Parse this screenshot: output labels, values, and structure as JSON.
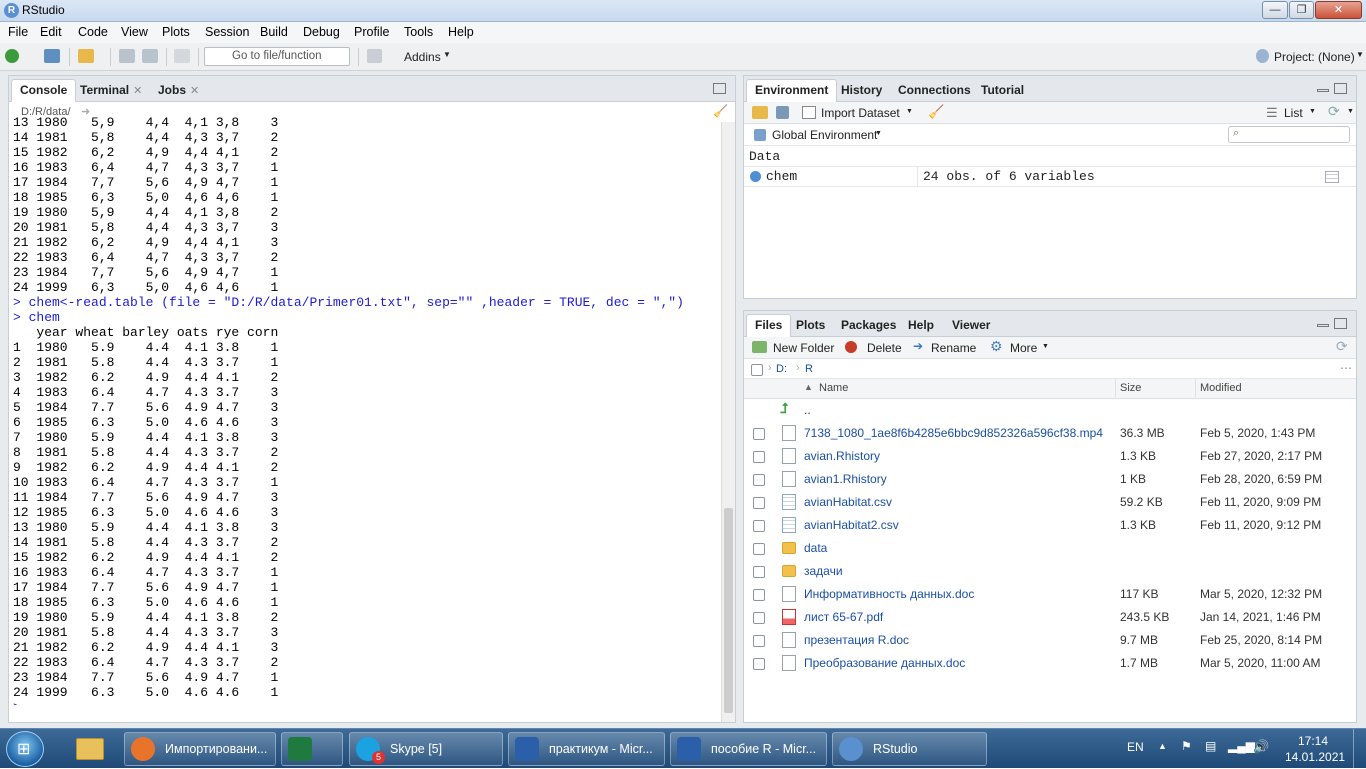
{
  "window": {
    "title": "RStudio",
    "minimize": "—",
    "maximize": "❐",
    "close": "✕"
  },
  "menu": [
    "File",
    "Edit",
    "Code",
    "View",
    "Plots",
    "Session",
    "Build",
    "Debug",
    "Profile",
    "Tools",
    "Help"
  ],
  "toolbar": {
    "goto_placeholder": "Go to file/function",
    "addins": "Addins",
    "project": "Project: (None)"
  },
  "console": {
    "tabs": [
      {
        "label": "Console"
      },
      {
        "label": "Terminal"
      },
      {
        "label": "Jobs"
      }
    ],
    "path": "D:/R/data/",
    "lines": [
      {
        "text": "13 1980   5,9    4,4  4,1 3,8    3",
        "type": "out"
      },
      {
        "text": "14 1981   5,8    4,4  4,3 3,7    2",
        "type": "out"
      },
      {
        "text": "15 1982   6,2    4,9  4,4 4,1    2",
        "type": "out"
      },
      {
        "text": "16 1983   6,4    4,7  4,3 3,7    1",
        "type": "out"
      },
      {
        "text": "17 1984   7,7    5,6  4,9 4,7    1",
        "type": "out"
      },
      {
        "text": "18 1985   6,3    5,0  4,6 4,6    1",
        "type": "out"
      },
      {
        "text": "19 1980   5,9    4,4  4,1 3,8    2",
        "type": "out"
      },
      {
        "text": "20 1981   5,8    4,4  4,3 3,7    3",
        "type": "out"
      },
      {
        "text": "21 1982   6,2    4,9  4,4 4,1    3",
        "type": "out"
      },
      {
        "text": "22 1983   6,4    4,7  4,3 3,7    2",
        "type": "out"
      },
      {
        "text": "23 1984   7,7    5,6  4,9 4,7    1",
        "type": "out"
      },
      {
        "text": "24 1999   6,3    5,0  4,6 4,6    1",
        "type": "out"
      },
      {
        "text": "> chem<-read.table (file = \"D:/R/data/Primer01.txt\", sep=\"\" ,header = TRUE, dec = \",\")",
        "type": "cmd"
      },
      {
        "text": "> chem",
        "type": "cmd"
      },
      {
        "text": "   year wheat barley oats rye corn",
        "type": "out"
      },
      {
        "text": "1  1980   5.9    4.4  4.1 3.8    1",
        "type": "out"
      },
      {
        "text": "2  1981   5.8    4.4  4.3 3.7    1",
        "type": "out"
      },
      {
        "text": "3  1982   6.2    4.9  4.4 4.1    2",
        "type": "out"
      },
      {
        "text": "4  1983   6.4    4.7  4.3 3.7    3",
        "type": "out"
      },
      {
        "text": "5  1984   7.7    5.6  4.9 4.7    3",
        "type": "out"
      },
      {
        "text": "6  1985   6.3    5.0  4.6 4.6    3",
        "type": "out"
      },
      {
        "text": "7  1980   5.9    4.4  4.1 3.8    3",
        "type": "out"
      },
      {
        "text": "8  1981   5.8    4.4  4.3 3.7    2",
        "type": "out"
      },
      {
        "text": "9  1982   6.2    4.9  4.4 4.1    2",
        "type": "out"
      },
      {
        "text": "10 1983   6.4    4.7  4.3 3.7    1",
        "type": "out"
      },
      {
        "text": "11 1984   7.7    5.6  4.9 4.7    3",
        "type": "out"
      },
      {
        "text": "12 1985   6.3    5.0  4.6 4.6    3",
        "type": "out"
      },
      {
        "text": "13 1980   5.9    4.4  4.1 3.8    3",
        "type": "out"
      },
      {
        "text": "14 1981   5.8    4.4  4.3 3.7    2",
        "type": "out"
      },
      {
        "text": "15 1982   6.2    4.9  4.4 4.1    2",
        "type": "out"
      },
      {
        "text": "16 1983   6.4    4.7  4.3 3.7    1",
        "type": "out"
      },
      {
        "text": "17 1984   7.7    5.6  4.9 4.7    1",
        "type": "out"
      },
      {
        "text": "18 1985   6.3    5.0  4.6 4.6    1",
        "type": "out"
      },
      {
        "text": "19 1980   5.9    4.4  4.1 3.8    2",
        "type": "out"
      },
      {
        "text": "20 1981   5.8    4.4  4.3 3.7    3",
        "type": "out"
      },
      {
        "text": "21 1982   6.2    4.9  4.4 4.1    3",
        "type": "out"
      },
      {
        "text": "22 1983   6.4    4.7  4.3 3.7    2",
        "type": "out"
      },
      {
        "text": "23 1984   7.7    5.6  4.9 4.7    1",
        "type": "out"
      },
      {
        "text": "24 1999   6.3    5.0  4.6 4.6    1",
        "type": "out"
      },
      {
        "text": ">",
        "type": "cmd"
      }
    ]
  },
  "environment": {
    "tabs": [
      {
        "label": "Environment"
      },
      {
        "label": "History"
      },
      {
        "label": "Connections"
      },
      {
        "label": "Tutorial"
      }
    ],
    "import_dataset": "Import Dataset",
    "list_view": "List",
    "scope": "Global Environment",
    "section": "Data",
    "rows": [
      {
        "name": "chem",
        "value": "24 obs. of 6 variables"
      }
    ]
  },
  "files": {
    "tabs": [
      {
        "label": "Files"
      },
      {
        "label": "Plots"
      },
      {
        "label": "Packages"
      },
      {
        "label": "Help"
      },
      {
        "label": "Viewer"
      }
    ],
    "new_folder": "New Folder",
    "delete": "Delete",
    "rename": "Rename",
    "more": "More",
    "breadcrumb": [
      "D:",
      "R"
    ],
    "columns": {
      "name": "Name",
      "size": "Size",
      "modified": "Modified"
    },
    "up": "..",
    "items": [
      {
        "name": "7138_1080_1ae8f6b4285e6bbc9d852326a596cf38.mp4",
        "size": "36.3 MB",
        "modified": "Feb 5, 2020, 1:43 PM",
        "kind": "doc"
      },
      {
        "name": "avian.Rhistory",
        "size": "1.3 KB",
        "modified": "Feb 27, 2020, 2:17 PM",
        "kind": "rhist"
      },
      {
        "name": "avian1.Rhistory",
        "size": "1 KB",
        "modified": "Feb 28, 2020, 6:59 PM",
        "kind": "rhist"
      },
      {
        "name": "avianHabitat.csv",
        "size": "59.2 KB",
        "modified": "Feb 11, 2020, 9:09 PM",
        "kind": "csv"
      },
      {
        "name": "avianHabitat2.csv",
        "size": "1.3 KB",
        "modified": "Feb 11, 2020, 9:12 PM",
        "kind": "csv"
      },
      {
        "name": "data",
        "size": "",
        "modified": "",
        "kind": "folder"
      },
      {
        "name": "задачи",
        "size": "",
        "modified": "",
        "kind": "folder"
      },
      {
        "name": "Информативность данных.doc",
        "size": "117 KB",
        "modified": "Mar 5, 2020, 12:32 PM",
        "kind": "doc"
      },
      {
        "name": "лист 65-67.pdf",
        "size": "243.5 KB",
        "modified": "Jan 14, 2021, 1:46 PM",
        "kind": "pdf"
      },
      {
        "name": "презентация R.doc",
        "size": "9.7 MB",
        "modified": "Feb 25, 2020, 8:14 PM",
        "kind": "doc"
      },
      {
        "name": "Преобразование данных.doc",
        "size": "1.7 MB",
        "modified": "Mar 5, 2020, 11:00 AM",
        "kind": "doc"
      }
    ]
  },
  "taskbar": {
    "tasks": [
      {
        "label": "Импортировани...",
        "icon": "firefox-icon",
        "color": "#e8732a"
      },
      {
        "label": "",
        "icon": "excel-icon",
        "color": "#1e7a3e"
      },
      {
        "label": "Skype [5]",
        "icon": "skype-icon",
        "color": "#1aa3e0",
        "badge": "5"
      },
      {
        "label": "практикум - Micr...",
        "icon": "word-icon",
        "color": "#2b5faa"
      },
      {
        "label": "пособие R - Micr...",
        "icon": "word-icon",
        "color": "#2b5faa"
      },
      {
        "label": "RStudio",
        "icon": "rstudio-icon",
        "color": "#5a8fd0"
      }
    ],
    "lang": "EN",
    "time": "17:14",
    "date": "14.01.2021"
  }
}
